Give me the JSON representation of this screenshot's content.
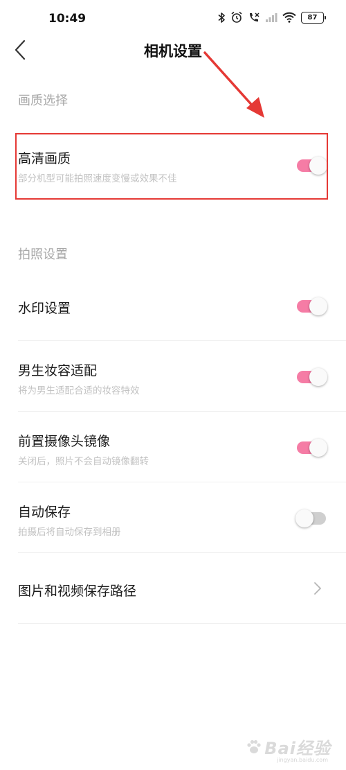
{
  "status_bar": {
    "time": "10:49",
    "battery": "87",
    "icons": [
      "bluetooth-icon",
      "alarm-icon",
      "call-muted-icon",
      "signal-icon",
      "wifi-icon",
      "battery-icon"
    ]
  },
  "header": {
    "title": "相机设置",
    "back_icon": "chevron-left-icon"
  },
  "sections": [
    {
      "header": "画质选择",
      "items": [
        {
          "title": "高清画质",
          "subtitle": "部分机型可能拍照速度变慢或效果不佳",
          "toggle": true
        }
      ]
    },
    {
      "header": "拍照设置",
      "items": [
        {
          "title": "水印设置",
          "toggle": true
        },
        {
          "title": "男生妆容适配",
          "subtitle": "将为男生适配合适的妆容特效",
          "toggle": true
        },
        {
          "title": "前置摄像头镜像",
          "subtitle": "关闭后，照片不会自动镜像翻转",
          "toggle": true
        },
        {
          "title": "自动保存",
          "subtitle": "拍摄后将自动保存到相册",
          "toggle": false
        },
        {
          "title": "图片和视频保存路径",
          "action_icon": "chevron-right-icon"
        }
      ]
    }
  ],
  "watermark": {
    "text": "Bai经验",
    "sub": "jingyan.baidu.com"
  },
  "colors": {
    "toggle_on": "#f57ca5",
    "toggle_off": "#cfcfcf",
    "annotation_red": "#e53935"
  }
}
